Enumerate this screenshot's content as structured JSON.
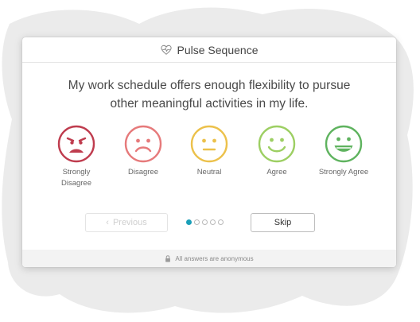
{
  "header": {
    "title": "Pulse Sequence",
    "icon": "heart-pulse-icon"
  },
  "question": "My work schedule offers enough flexibility to pursue other meaningful activities in my life.",
  "scale": [
    {
      "label": "Strongly Disagree",
      "icon": "angry-face-icon",
      "color": "#bf3c4e"
    },
    {
      "label": "Disagree",
      "icon": "sad-face-icon",
      "color": "#e67a7b"
    },
    {
      "label": "Neutral",
      "icon": "neutral-face-icon",
      "color": "#ecc14b"
    },
    {
      "label": "Agree",
      "icon": "smile-face-icon",
      "color": "#9dcf63"
    },
    {
      "label": "Strongly Agree",
      "icon": "grin-face-icon",
      "color": "#5fb35f"
    }
  ],
  "nav": {
    "previous_label": "Previous",
    "skip_label": "Skip",
    "total_steps": 5,
    "current_step": 1,
    "accent_color": "#1a9fb8"
  },
  "footer": {
    "text": "All answers are anonymous",
    "icon": "lock-icon"
  }
}
